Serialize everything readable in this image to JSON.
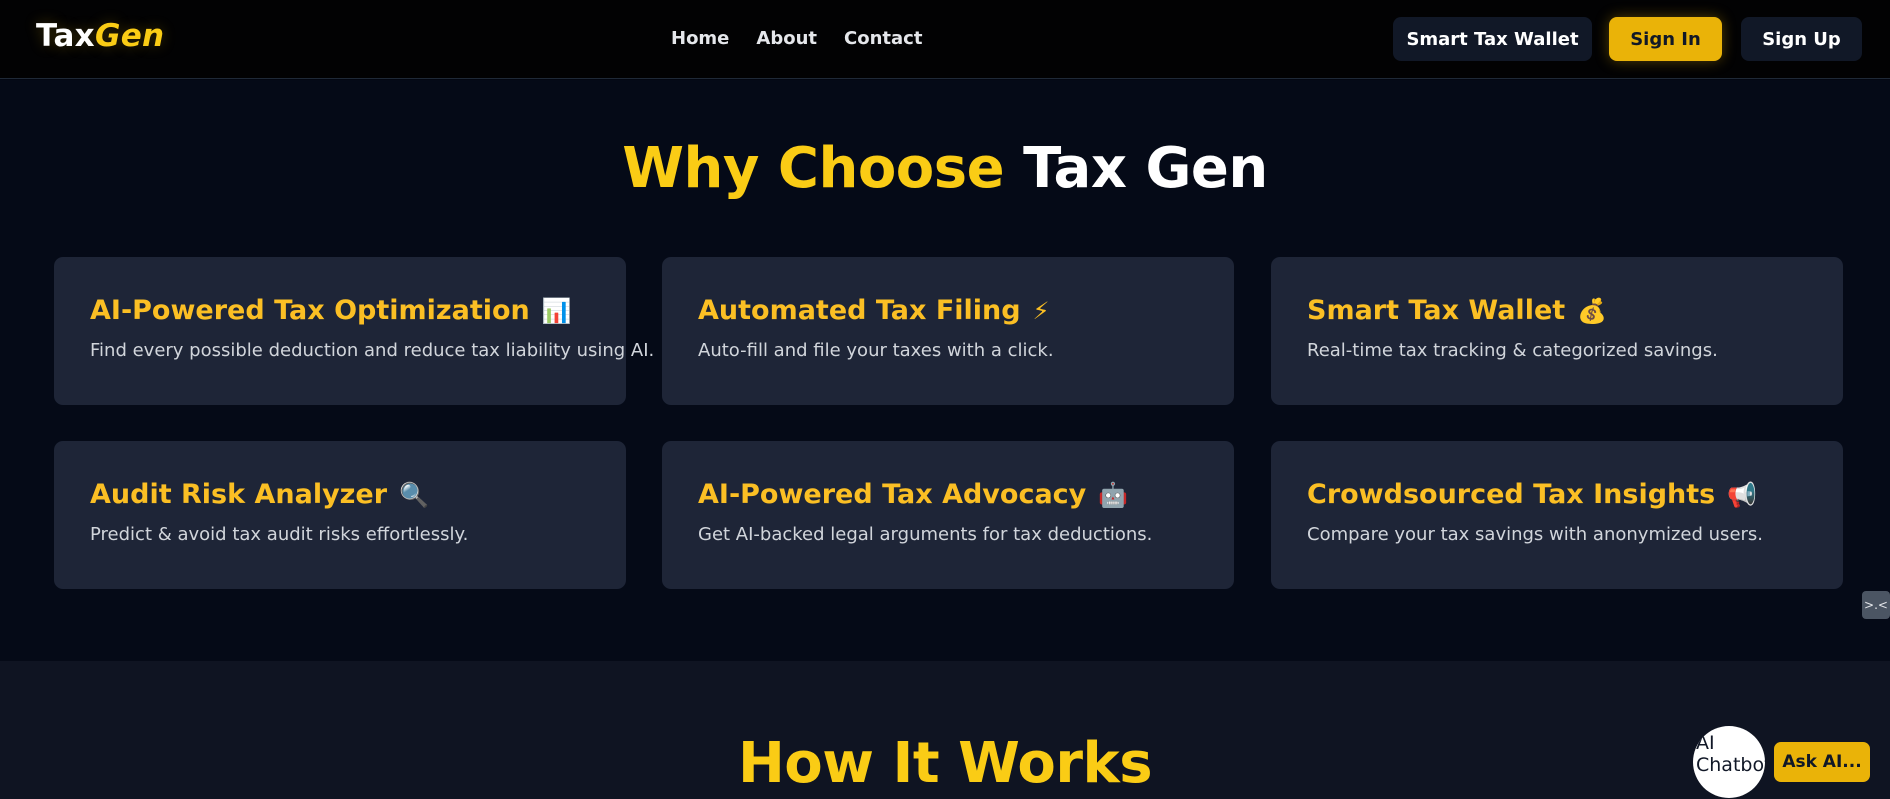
{
  "navbar": {
    "brand_part1": "Tax",
    "brand_part2": "Gen",
    "links": [
      "Home",
      "About",
      "Contact"
    ],
    "wallet_label": "Smart Tax Wallet",
    "signin_label": "Sign In",
    "signup_label": "Sign Up"
  },
  "why": {
    "title_part1": "Why Choose",
    "title_part2": "Tax Gen",
    "features": [
      {
        "title": "AI-Powered Tax Optimization",
        "icon": "📊",
        "icon_name": "bar-chart-icon",
        "desc": "Find every possible deduction and reduce tax liability using AI."
      },
      {
        "title": "Automated Tax Filing",
        "icon": "⚡",
        "icon_name": "lightning-icon",
        "desc": "Auto-fill and file your taxes with a click."
      },
      {
        "title": "Smart Tax Wallet",
        "icon": "💰",
        "icon_name": "money-bag-icon",
        "desc": "Real-time tax tracking & categorized savings."
      },
      {
        "title": "Audit Risk Analyzer",
        "icon": "🔍",
        "icon_name": "magnifier-icon",
        "desc": "Predict & avoid tax audit risks effortlessly."
      },
      {
        "title": "AI-Powered Tax Advocacy",
        "icon": "🤖",
        "icon_name": "robot-icon",
        "desc": "Get AI-backed legal arguments for tax deductions."
      },
      {
        "title": "Crowdsourced Tax Insights",
        "icon": "📢",
        "icon_name": "megaphone-icon",
        "desc": "Compare your tax savings with anonymized users."
      }
    ]
  },
  "side_toggle": ">.<",
  "how": {
    "title": "How It Works"
  },
  "chatbot": {
    "avatar_alt": "AI Chatbot",
    "ask_label": "Ask AI..."
  },
  "colors": {
    "accent": "#facc15",
    "button_yellow": "#eab308",
    "card_bg": "#1e2537",
    "page_bg": "#050a17"
  }
}
